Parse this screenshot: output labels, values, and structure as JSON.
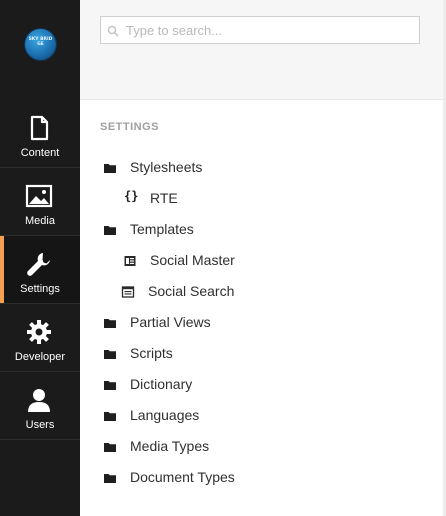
{
  "logo": {
    "text": "SKY BRID GE"
  },
  "nav": {
    "items": [
      {
        "label": "Content",
        "icon": "document-icon"
      },
      {
        "label": "Media",
        "icon": "image-icon"
      },
      {
        "label": "Settings",
        "icon": "wrench-icon",
        "active": true
      },
      {
        "label": "Developer",
        "icon": "gear-icon"
      },
      {
        "label": "Users",
        "icon": "user-icon"
      }
    ]
  },
  "search": {
    "placeholder": "Type to search..."
  },
  "tree": {
    "section_title": "SETTINGS",
    "items": [
      {
        "label": "Stylesheets",
        "icon": "folder-icon",
        "level": 0
      },
      {
        "label": "RTE",
        "icon": "braces-icon",
        "level": 1
      },
      {
        "label": "Templates",
        "icon": "folder-icon",
        "level": 0
      },
      {
        "label": "Social Master",
        "icon": "template-icon",
        "level": 1
      },
      {
        "label": "Social Search",
        "icon": "template-outline-icon",
        "level": 1
      },
      {
        "label": "Partial Views",
        "icon": "folder-icon",
        "level": 0
      },
      {
        "label": "Scripts",
        "icon": "folder-icon",
        "level": 0
      },
      {
        "label": "Dictionary",
        "icon": "folder-icon",
        "level": 0
      },
      {
        "label": "Languages",
        "icon": "folder-icon",
        "level": 0
      },
      {
        "label": "Media Types",
        "icon": "folder-icon",
        "level": 0
      },
      {
        "label": "Document Types",
        "icon": "folder-icon",
        "level": 0
      }
    ]
  },
  "colors": {
    "nav_bg": "#1b1b1b",
    "active_accent": "#f5a050",
    "header_bg": "#f6f6f6",
    "section_title": "#a0a0a0"
  }
}
